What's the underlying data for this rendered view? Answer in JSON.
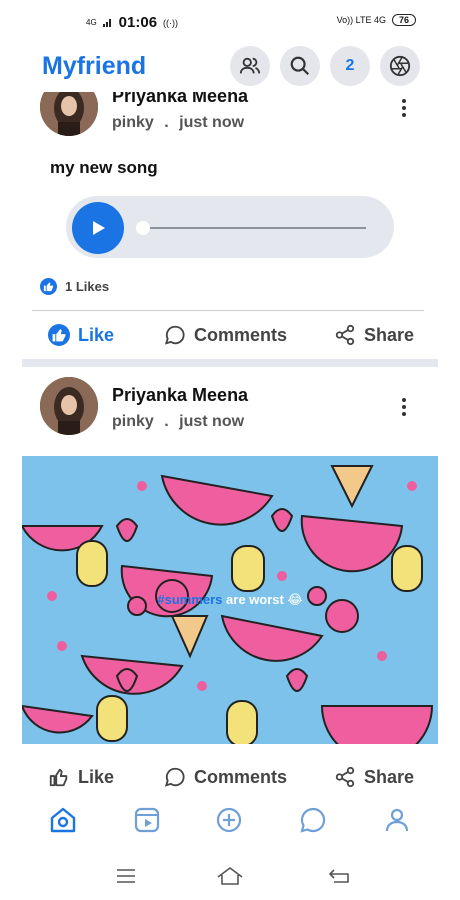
{
  "status_bar": {
    "network": "4G",
    "time": "01:06",
    "signal_right": "Vo)) LTE 4G",
    "battery": "76"
  },
  "app": {
    "brand": "Myfriend",
    "notification_count": "2"
  },
  "posts": [
    {
      "author": "Priyanka Meena",
      "username": "pinky",
      "separator": ".",
      "time": "just now",
      "caption": "my new song",
      "likes_text": "1 Likes",
      "actions": {
        "like": "Like",
        "comments": "Comments",
        "share": "Share"
      }
    },
    {
      "author": "Priyanka Meena",
      "username": "pinky",
      "separator": ".",
      "time": "just now",
      "image_hashtag": "#summers",
      "image_caption": "are worst 😂",
      "actions": {
        "like": "Like",
        "comments": "Comments",
        "share": "Share"
      }
    }
  ],
  "colors": {
    "accent": "#1b74e4",
    "chip": "#e4e6eb",
    "audio_bg": "#e4e8ee",
    "image_bg": "#7cc2ea"
  }
}
